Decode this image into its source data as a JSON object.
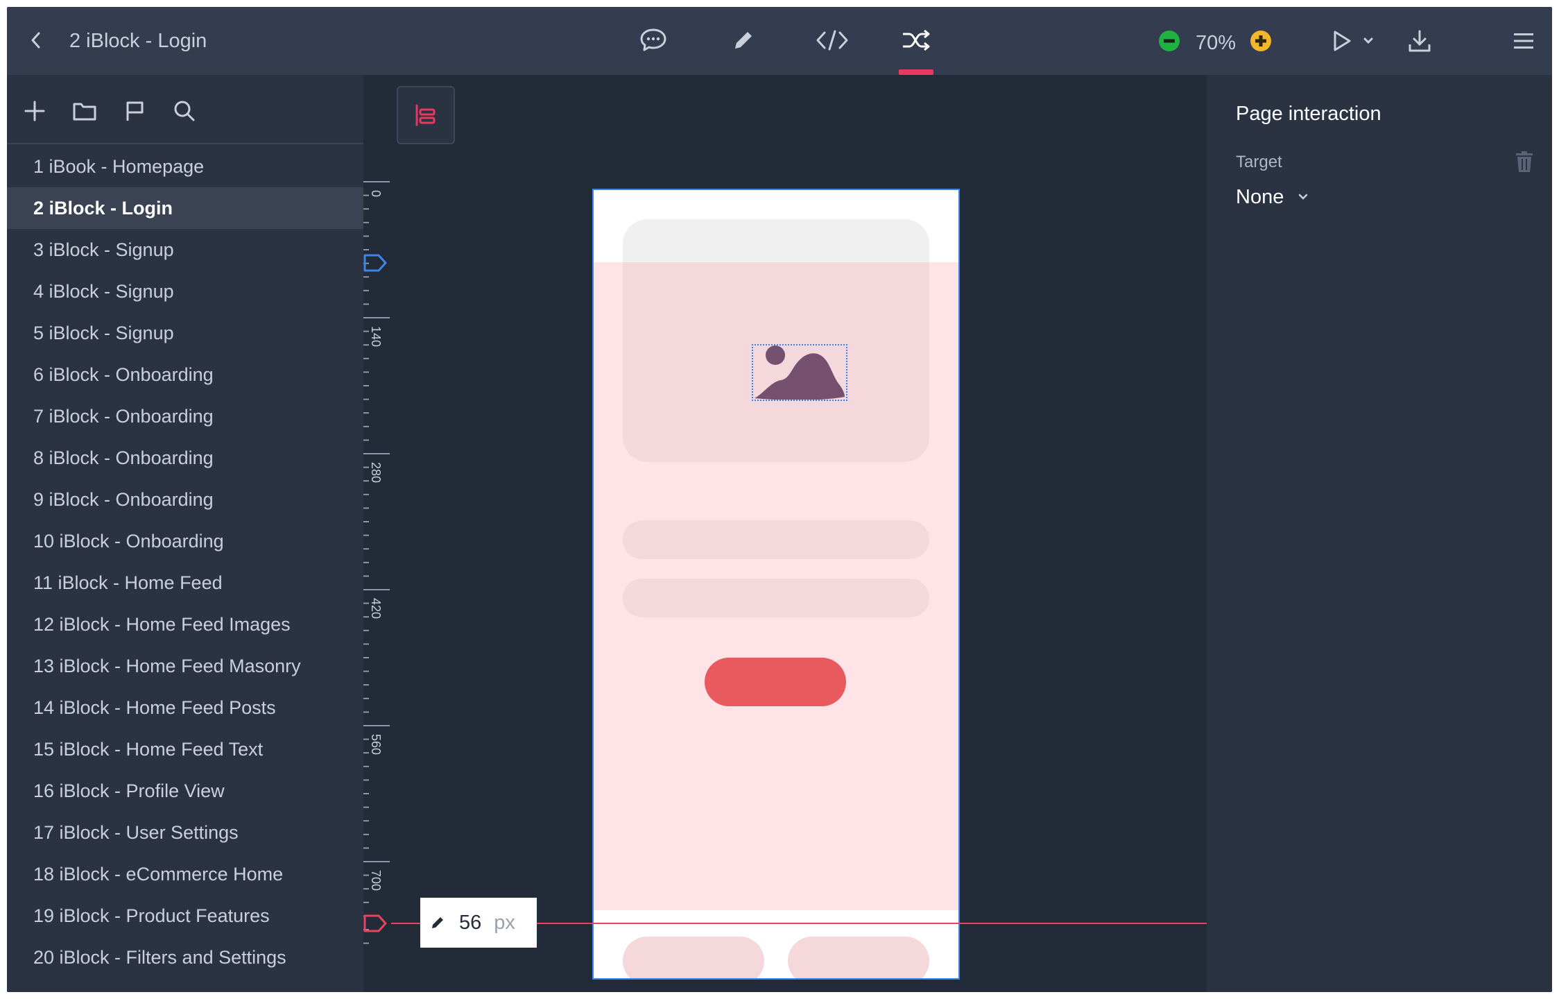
{
  "header": {
    "title": "2 iBlock - Login",
    "zoom": "70%",
    "active_tool": "interactions",
    "tools": [
      "comments",
      "edit",
      "code",
      "interactions"
    ]
  },
  "sidebar": {
    "items": [
      {
        "label": "1 iBook - Homepage"
      },
      {
        "label": "2 iBlock - Login",
        "active": true
      },
      {
        "label": "3 iBlock - Signup"
      },
      {
        "label": "4 iBlock - Signup"
      },
      {
        "label": "5 iBlock - Signup"
      },
      {
        "label": "6 iBlock - Onboarding"
      },
      {
        "label": "7 iBlock - Onboarding"
      },
      {
        "label": "8 iBlock - Onboarding"
      },
      {
        "label": "9 iBlock - Onboarding"
      },
      {
        "label": "10 iBlock - Onboarding"
      },
      {
        "label": "11 iBlock - Home Feed"
      },
      {
        "label": "12 iBlock - Home Feed Images"
      },
      {
        "label": "13 iBlock - Home Feed Masonry"
      },
      {
        "label": "14 iBlock - Home Feed Posts"
      },
      {
        "label": "15 iBlock - Home Feed Text"
      },
      {
        "label": "16 iBlock - Profile View"
      },
      {
        "label": "17 iBlock - User Settings"
      },
      {
        "label": "18 iBlock - eCommerce Home"
      },
      {
        "label": "19 iBlock - Product Features"
      },
      {
        "label": "20 iBlock - Filters and Settings"
      }
    ]
  },
  "canvas": {
    "ruler_labels": [
      "0",
      "140",
      "280",
      "420",
      "560",
      "700"
    ],
    "fold_measure": {
      "value": "56",
      "unit": "px"
    }
  },
  "panel": {
    "title": "Page interaction",
    "target_label": "Target",
    "target_value": "None"
  },
  "colors": {
    "accent": "#e83a61",
    "zoom_minus": "#1fb141",
    "zoom_plus": "#f2b62c",
    "phone_tint": "#ffe3e7",
    "primary_button": "#e85a5e",
    "selection": "#3b86e8"
  }
}
